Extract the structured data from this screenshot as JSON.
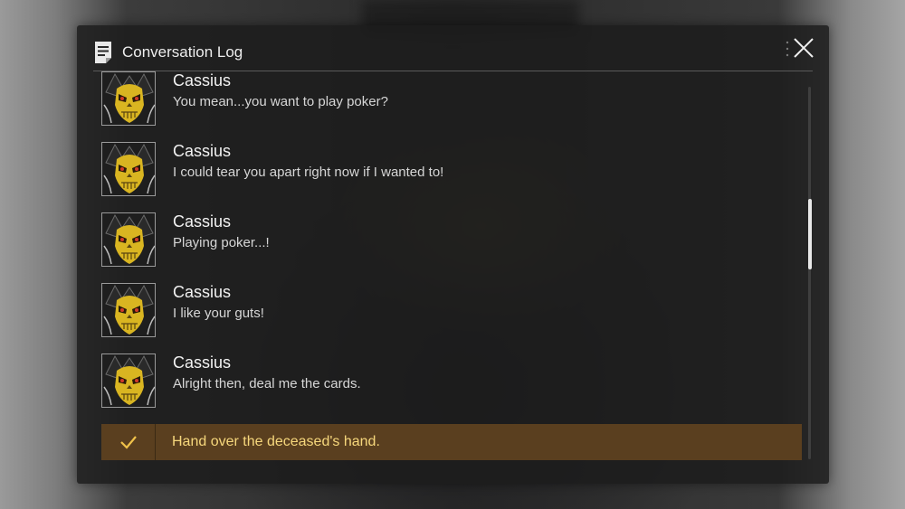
{
  "header": {
    "title": "Conversation Log",
    "icon": "log-document-icon",
    "close_icon": "close-icon"
  },
  "entries": [
    {
      "speaker": "Cassius",
      "text": "You mean...you want to play poker?",
      "avatar": "skull-avatar"
    },
    {
      "speaker": "Cassius",
      "text": "I could tear you apart right now if I wanted to!",
      "avatar": "skull-avatar"
    },
    {
      "speaker": "Cassius",
      "text": "Playing poker...!",
      "avatar": "skull-avatar"
    },
    {
      "speaker": "Cassius",
      "text": "I like your guts!",
      "avatar": "skull-avatar"
    },
    {
      "speaker": "Cassius",
      "text": "Alright then, deal me the cards.",
      "avatar": "skull-avatar"
    }
  ],
  "choice": {
    "text": "Hand over the deceased's hand.",
    "icon": "checkmark-icon",
    "selected": true
  },
  "colors": {
    "panel_bg": "#1c1c1c",
    "choice_bg": "#5a3f1f",
    "choice_text": "#f6d77c",
    "check": "#f0c24a"
  }
}
